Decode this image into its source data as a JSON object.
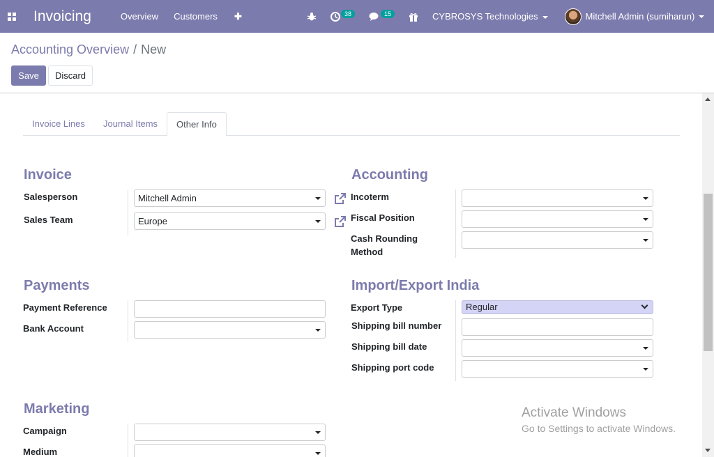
{
  "navbar": {
    "app_title": "Invoicing",
    "menu": [
      "Overview",
      "Customers"
    ],
    "plus": "✚",
    "bug_icon": "bug-icon",
    "activity_count": "38",
    "messages_count": "15",
    "company": "CYBROSYS Technologies",
    "user": "Mitchell Admin (sumiharun)",
    "color": "#7c7bad"
  },
  "breadcrumb": {
    "parent": "Accounting Overview",
    "separator": "/",
    "current": "New"
  },
  "buttons": {
    "save": "Save",
    "discard": "Discard"
  },
  "tabs": [
    "Invoice Lines",
    "Journal Items",
    "Other Info"
  ],
  "invoice": {
    "title": "Invoice",
    "salesperson_label": "Salesperson",
    "salesperson_value": "Mitchell Admin",
    "sales_team_label": "Sales Team",
    "sales_team_value": "Europe"
  },
  "accounting": {
    "title": "Accounting",
    "incoterm_label": "Incoterm",
    "incoterm_value": "",
    "fiscal_position_label": "Fiscal Position",
    "fiscal_position_value": "",
    "cash_rounding_label": "Cash Rounding Method",
    "cash_rounding_value": ""
  },
  "payments": {
    "title": "Payments",
    "payment_reference_label": "Payment Reference",
    "payment_reference_value": "",
    "bank_account_label": "Bank Account",
    "bank_account_value": ""
  },
  "import_export": {
    "title": "Import/Export India",
    "export_type_label": "Export Type",
    "export_type_value": "Regular",
    "shipping_bill_number_label": "Shipping bill number",
    "shipping_bill_number_value": "",
    "shipping_bill_date_label": "Shipping bill date",
    "shipping_bill_date_value": "",
    "shipping_port_code_label": "Shipping port code",
    "shipping_port_code_value": ""
  },
  "marketing": {
    "title": "Marketing",
    "campaign_label": "Campaign",
    "campaign_value": "",
    "medium_label": "Medium",
    "medium_value": ""
  },
  "watermark": {
    "title": "Activate Windows",
    "subtitle": "Go to Settings to activate Windows."
  }
}
